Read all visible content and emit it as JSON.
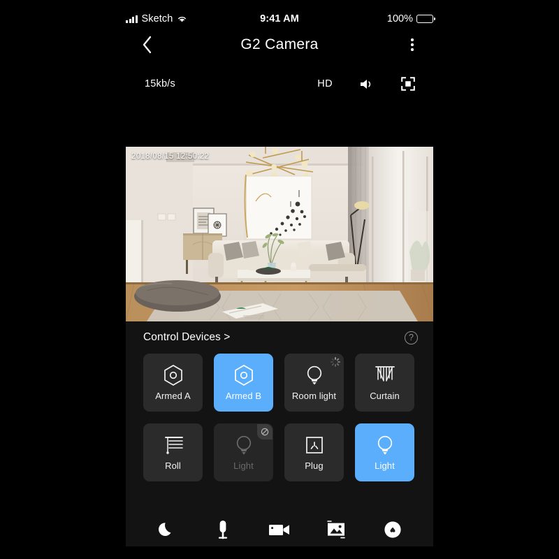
{
  "status_bar": {
    "carrier": "Sketch",
    "time": "9:41 AM",
    "battery_percent": "100%",
    "signal_icon": "signal-bars-icon",
    "wifi_icon": "wifi-icon",
    "battery_icon": "battery-full-icon"
  },
  "nav": {
    "back_icon": "chevron-left-icon",
    "title": "G2 Camera",
    "more_icon": "more-vertical-icon"
  },
  "stream": {
    "bitrate": "15kb/s",
    "quality": "HD",
    "speaker_icon": "speaker-on-icon",
    "fullscreen_icon": "fullscreen-icon"
  },
  "video": {
    "timestamp": "2018/08/15 12:50:22",
    "scene": "living-room-camera-feed"
  },
  "panel": {
    "title": "Control Devices >",
    "help_icon": "question-mark-circle-icon",
    "devices": [
      {
        "label": "Armed A",
        "icon": "shield-hexagon-icon",
        "state": "off",
        "badge": "none"
      },
      {
        "label": "Armed B",
        "icon": "shield-hexagon-icon",
        "state": "active",
        "badge": "none"
      },
      {
        "label": "Room light",
        "icon": "bulb-icon",
        "state": "loading",
        "badge": "spinner"
      },
      {
        "label": "Curtain",
        "icon": "curtain-icon",
        "state": "off",
        "badge": "none"
      },
      {
        "label": "Roll",
        "icon": "roller-blind-icon",
        "state": "off",
        "badge": "none"
      },
      {
        "label": "Light",
        "icon": "bulb-icon",
        "state": "disabled",
        "badge": "blocked"
      },
      {
        "label": "Plug",
        "icon": "power-outlet-icon",
        "state": "off",
        "badge": "none"
      },
      {
        "label": "Light",
        "icon": "bulb-icon",
        "state": "active",
        "badge": "none"
      }
    ]
  },
  "bottom_bar": {
    "buttons": [
      {
        "name": "night-mode-button",
        "icon": "moon-icon"
      },
      {
        "name": "talk-button",
        "icon": "microphone-icon"
      },
      {
        "name": "record-button",
        "icon": "video-camera-icon"
      },
      {
        "name": "snapshot-button",
        "icon": "photo-icon"
      },
      {
        "name": "favorite-button",
        "icon": "heart-circle-icon"
      }
    ]
  },
  "colors": {
    "background": "#000000",
    "panel": "#131313",
    "tile": "#2b2b2b",
    "tile_disabled": "#262626",
    "accent": "#5aaefb",
    "text": "#ffffff",
    "text_muted": "#8e8e8e"
  }
}
